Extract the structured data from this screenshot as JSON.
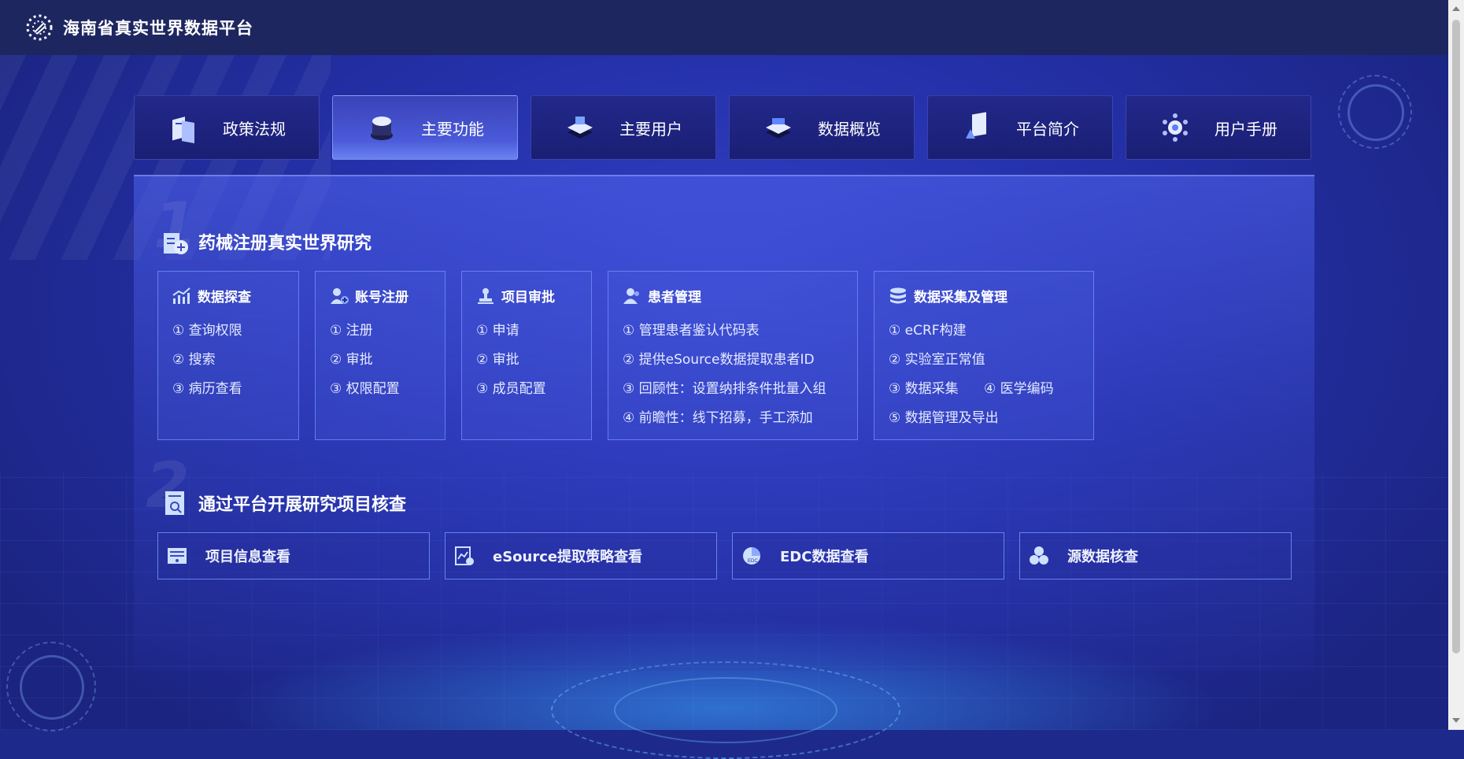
{
  "header": {
    "title": "海南省真实世界数据平台"
  },
  "tabs": [
    {
      "label": "政策法规",
      "icon": "policy-icon"
    },
    {
      "label": "主要功能",
      "icon": "function-icon",
      "active": true
    },
    {
      "label": "主要用户",
      "icon": "users-icon"
    },
    {
      "label": "数据概览",
      "icon": "data-overview-icon"
    },
    {
      "label": "平台简介",
      "icon": "platform-intro-icon"
    },
    {
      "label": "用户手册",
      "icon": "manual-icon"
    }
  ],
  "section1": {
    "number": "1",
    "title": "药械注册真实世界研究",
    "cards": [
      {
        "title": "数据探查",
        "icon": "chart-trend-icon",
        "items": [
          "① 查询权限",
          "② 搜索",
          "③ 病历查看"
        ]
      },
      {
        "title": "账号注册",
        "icon": "user-add-icon",
        "items": [
          "① 注册",
          "② 审批",
          "③ 权限配置"
        ]
      },
      {
        "title": "项目审批",
        "icon": "stamp-icon",
        "items": [
          "① 申请",
          "② 审批",
          "③ 成员配置"
        ]
      },
      {
        "title": "患者管理",
        "icon": "patients-icon",
        "items": [
          "① 管理患者鉴认代码表",
          "② 提供eSource数据提取患者ID",
          "③ 回顾性：设置纳排条件批量入组",
          "④ 前瞻性：线下招募，手工添加"
        ]
      },
      {
        "title": "数据采集及管理",
        "icon": "database-icon",
        "items": [
          "① eCRF构建",
          "② 实验室正常值",
          "③ 数据采集",
          "④ 医学编码",
          "⑤ 数据管理及导出"
        ]
      }
    ]
  },
  "section2": {
    "number": "2",
    "title": "通过平台开展研究项目核查",
    "buttons": [
      {
        "label": "项目信息查看",
        "icon": "project-info-icon"
      },
      {
        "label": "eSource提取策略查看",
        "icon": "strategy-icon"
      },
      {
        "label": "EDC数据查看",
        "icon": "edc-pie-icon"
      },
      {
        "label": "源数据核查",
        "icon": "source-data-icon"
      }
    ]
  }
}
